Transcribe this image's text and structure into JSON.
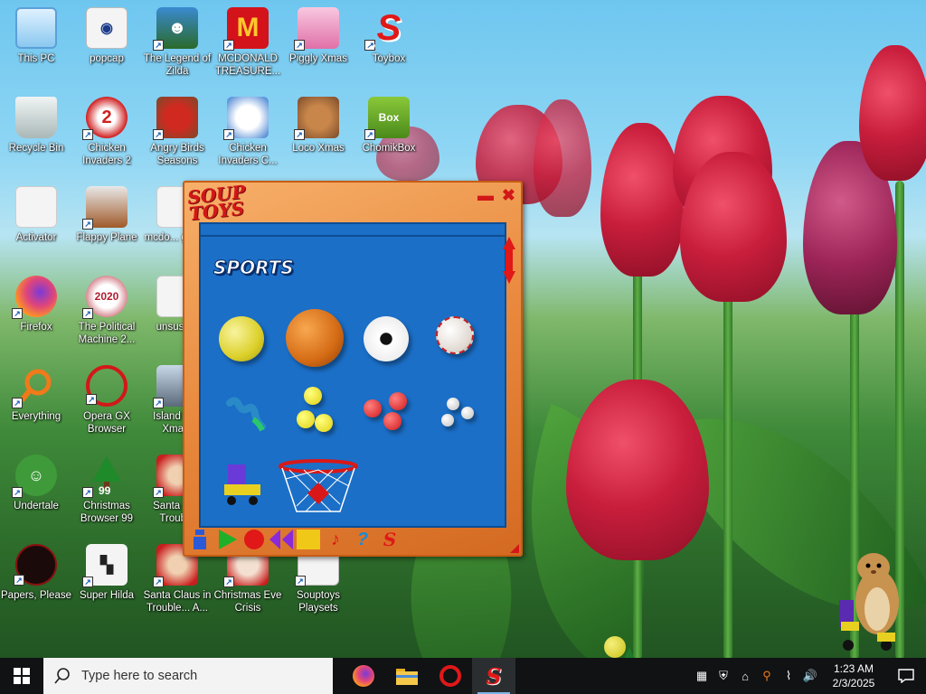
{
  "desktop": {
    "icons": [
      {
        "label": "This PC"
      },
      {
        "label": "popcap"
      },
      {
        "label": "The Legend of Zilda"
      },
      {
        "label": "MCDONALD TREASURE..."
      },
      {
        "label": "Piggly Xmas"
      },
      {
        "label": "Toybox"
      },
      {
        "label": "Recycle Bin"
      },
      {
        "label": "Chicken Invaders 2"
      },
      {
        "label": "Angry Birds Seasons"
      },
      {
        "label": "Chicken Invaders C..."
      },
      {
        "label": "Loco Xmas"
      },
      {
        "label": "ChomikBox"
      },
      {
        "label": "Activator"
      },
      {
        "label": "Flappy Plane"
      },
      {
        "label": "mcdo... gam..."
      },
      {
        "label": "Firefox"
      },
      {
        "label": "The Political Machine 2..."
      },
      {
        "label": "unsusp..."
      },
      {
        "label": "Everything"
      },
      {
        "label": "Opera GX Browser"
      },
      {
        "label": "Island W... Xma..."
      },
      {
        "label": "Undertale"
      },
      {
        "label": "Christmas Browser 99"
      },
      {
        "label": "Santa Cl... Troub..."
      },
      {
        "label": "Papers, Please"
      },
      {
        "label": "Super Hilda"
      },
      {
        "label": "Santa Claus in Trouble... A..."
      },
      {
        "label": "Christmas Eve Crisis"
      },
      {
        "label": "Souptoys Playsets"
      }
    ]
  },
  "souptoys": {
    "logo": "SOUP TOYS",
    "minimize": "▬",
    "close": "✖",
    "category": "SPORTS",
    "toys": [
      "tennis-ball",
      "basketball",
      "soccer-ball",
      "baseball",
      "slinky",
      "yellow-balls",
      "red-balls",
      "white-balls",
      "roller-skate",
      "basketball-hoop"
    ],
    "colors": {
      "accent": "#d21818",
      "panel": "#1b6fc7",
      "frame": "#e8883d"
    }
  },
  "taskbar": {
    "search_placeholder": "Type here to search",
    "apps": [
      "firefox-icon",
      "file-explorer-icon",
      "opera-gx-icon",
      "souptoys-icon"
    ],
    "clock_time": "1:23 AM",
    "clock_date": "2/3/2025"
  }
}
